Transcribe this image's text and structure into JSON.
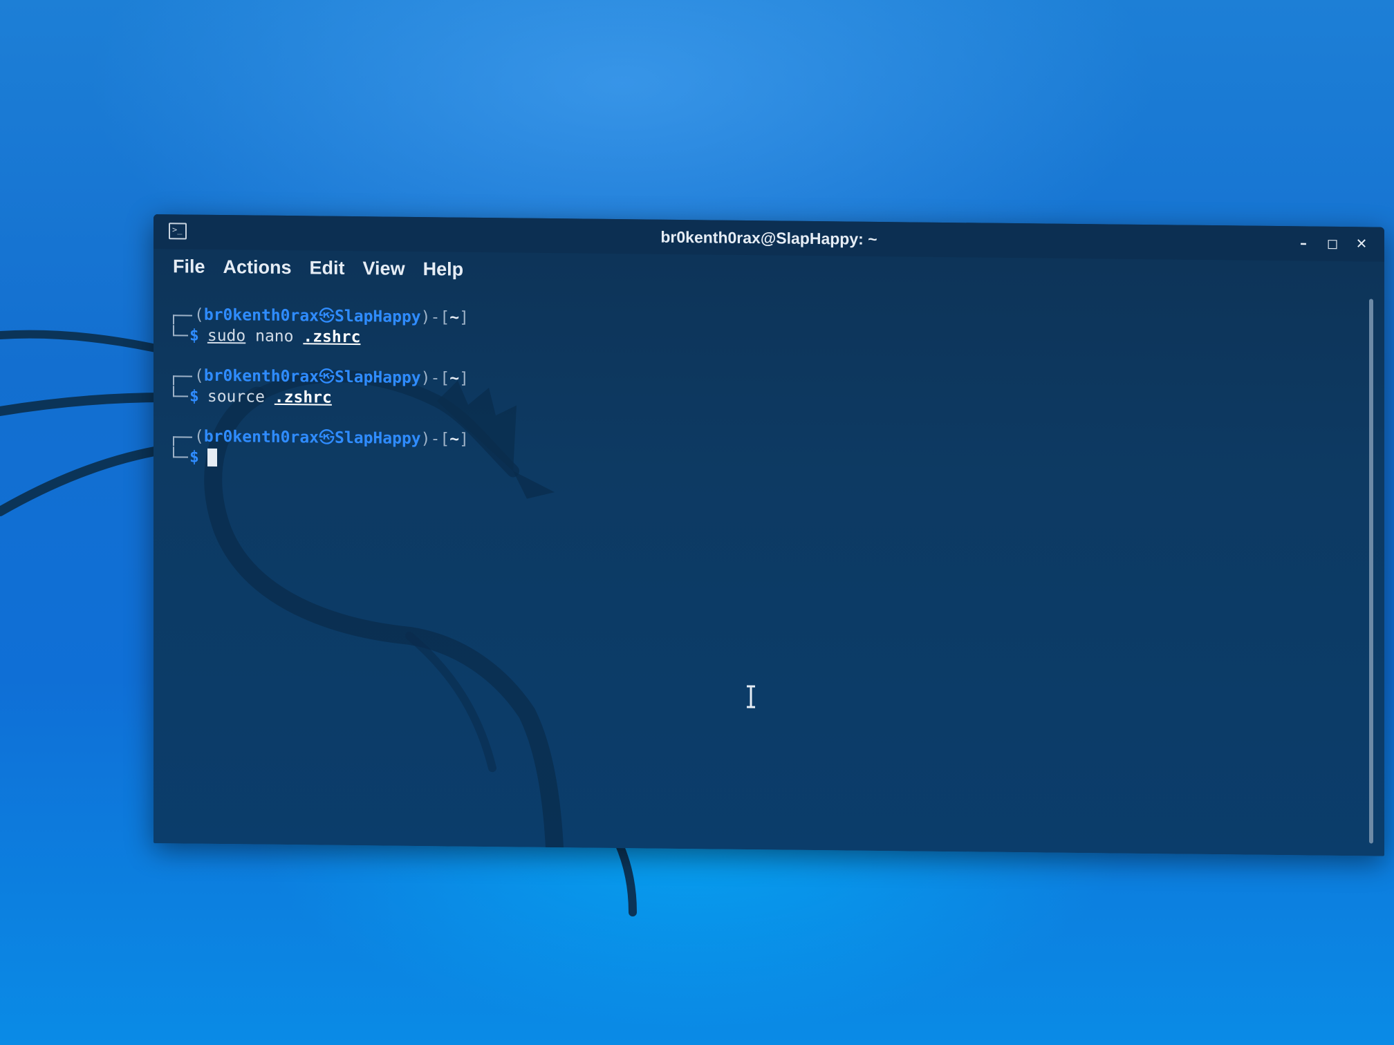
{
  "window": {
    "title": "br0kenth0rax@SlapHappy: ~",
    "controls": {
      "minimize": "–",
      "maximize": "◻",
      "close": "✕"
    }
  },
  "menu": {
    "items": [
      "File",
      "Actions",
      "Edit",
      "View",
      "Help"
    ]
  },
  "prompts": [
    {
      "user": "br0kenth0rax",
      "at": "㉿",
      "host": "SlapHappy",
      "dir": "~",
      "cmd_sudo": "sudo",
      "cmd_rest": " nano ",
      "cmd_file": ".zshrc"
    },
    {
      "user": "br0kenth0rax",
      "at": "㉿",
      "host": "SlapHappy",
      "dir": "~",
      "cmd_rest": "source ",
      "cmd_file": ".zshrc"
    },
    {
      "user": "br0kenth0rax",
      "at": "㉿",
      "host": "SlapHappy",
      "dir": "~"
    }
  ],
  "colors": {
    "prompt_blue": "#2f8cff",
    "terminal_bg": "#0d3a63",
    "desktop_bg": "#136fd0"
  },
  "icons": {
    "app": "terminal-icon",
    "pointer": "text-cursor-ibeam-icon"
  }
}
